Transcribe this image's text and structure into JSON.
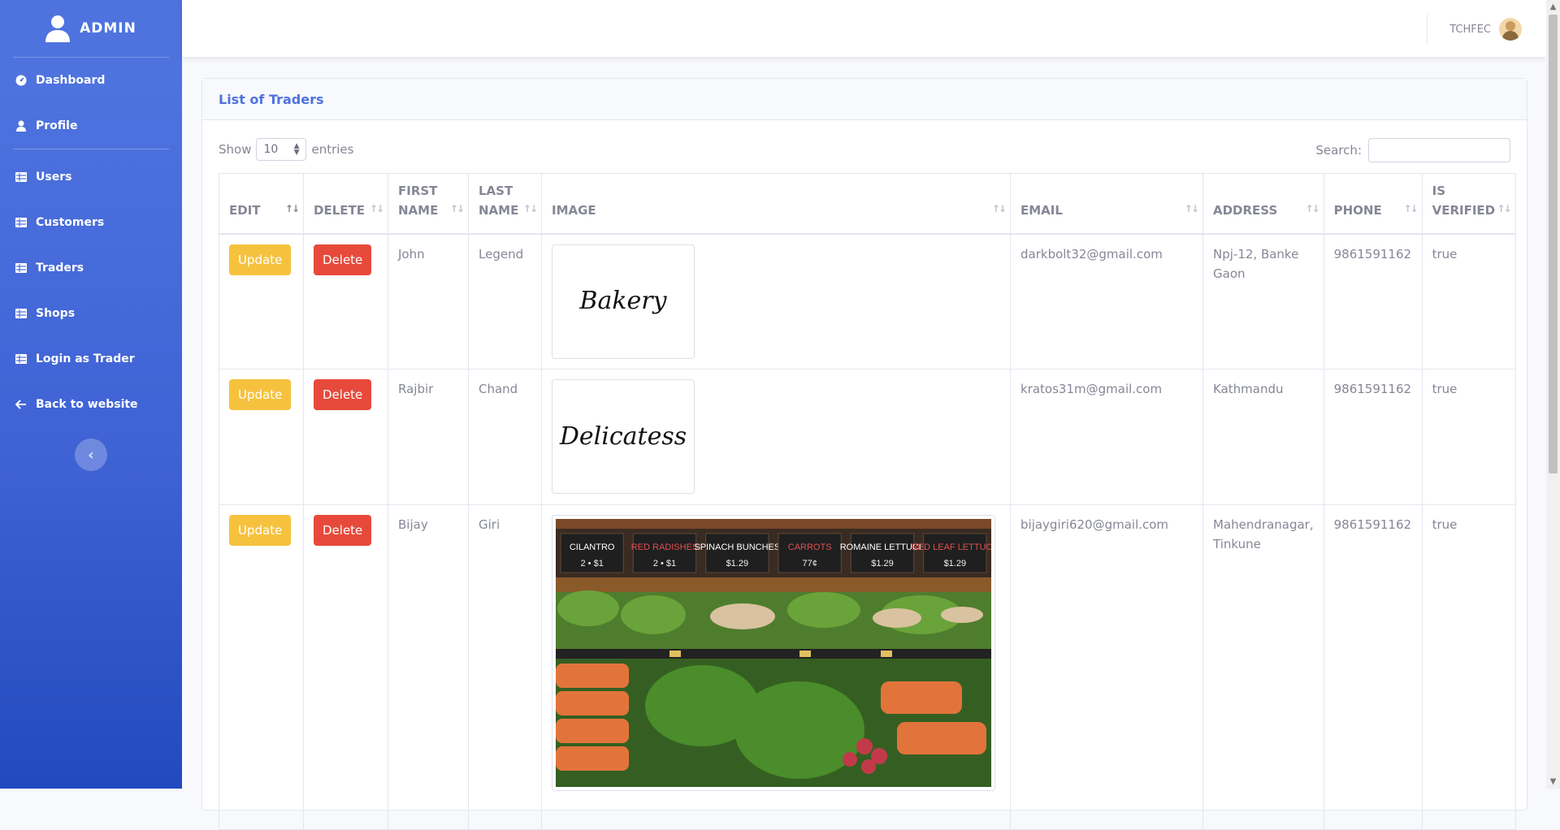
{
  "sidebar": {
    "brand": "ADMIN",
    "items": [
      {
        "label": "Dashboard",
        "icon": "tachometer-icon"
      },
      {
        "label": "Profile",
        "icon": "user-icon"
      },
      {
        "label": "Users",
        "icon": "table-icon"
      },
      {
        "label": "Customers",
        "icon": "table-icon"
      },
      {
        "label": "Traders",
        "icon": "table-icon"
      },
      {
        "label": "Shops",
        "icon": "table-icon"
      },
      {
        "label": "Login as Trader",
        "icon": "table-icon"
      },
      {
        "label": "Back to website",
        "icon": "arrow-left-icon"
      }
    ],
    "toggle": "‹"
  },
  "topbar": {
    "user_name": "TCHFEC"
  },
  "card": {
    "title": "List of Traders",
    "show_label": "Show",
    "entries_value": "10",
    "entries_label": "entries",
    "search_label": "Search:",
    "search_value": ""
  },
  "table": {
    "headers": {
      "edit": "EDIT",
      "delete": "DELETE",
      "first_name": "FIRST NAME",
      "last_name": "LAST NAME",
      "image": "IMAGE",
      "email": "EMAIL",
      "address": "ADDRESS",
      "phone": "PHONE",
      "is_verified": "IS VERIFIED"
    },
    "update_label": "Update",
    "delete_label": "Delete",
    "rows": [
      {
        "first": "John",
        "last": "Legend",
        "image_text": "Bakery",
        "email": "darkbolt32@gmail.com",
        "address": "Npj-12, Banke Gaon",
        "phone": "9861591162",
        "verified": "true"
      },
      {
        "first": "Rajbir",
        "last": "Chand",
        "image_text": "Delicatess",
        "email": "kratos31m@gmail.com",
        "address": "Kathmandu",
        "phone": "9861591162",
        "verified": "true"
      },
      {
        "first": "Bijay",
        "last": "Giri",
        "image_signs": [
          "CILANTRO",
          "RED RADISHES",
          "SPINACH BUNCHES",
          "CARROTS",
          "ROMAINE LETTUCE",
          "RED LEAF LETTUCE"
        ],
        "image_prices": [
          "2 • $1",
          "2 • $1",
          "$1.29",
          "77¢",
          "$1.29",
          "$1.29"
        ],
        "email": "bijaygiri620@gmail.com",
        "address": "Mahendranagar, Tinkune",
        "phone": "9861591162",
        "verified": "true"
      }
    ]
  }
}
